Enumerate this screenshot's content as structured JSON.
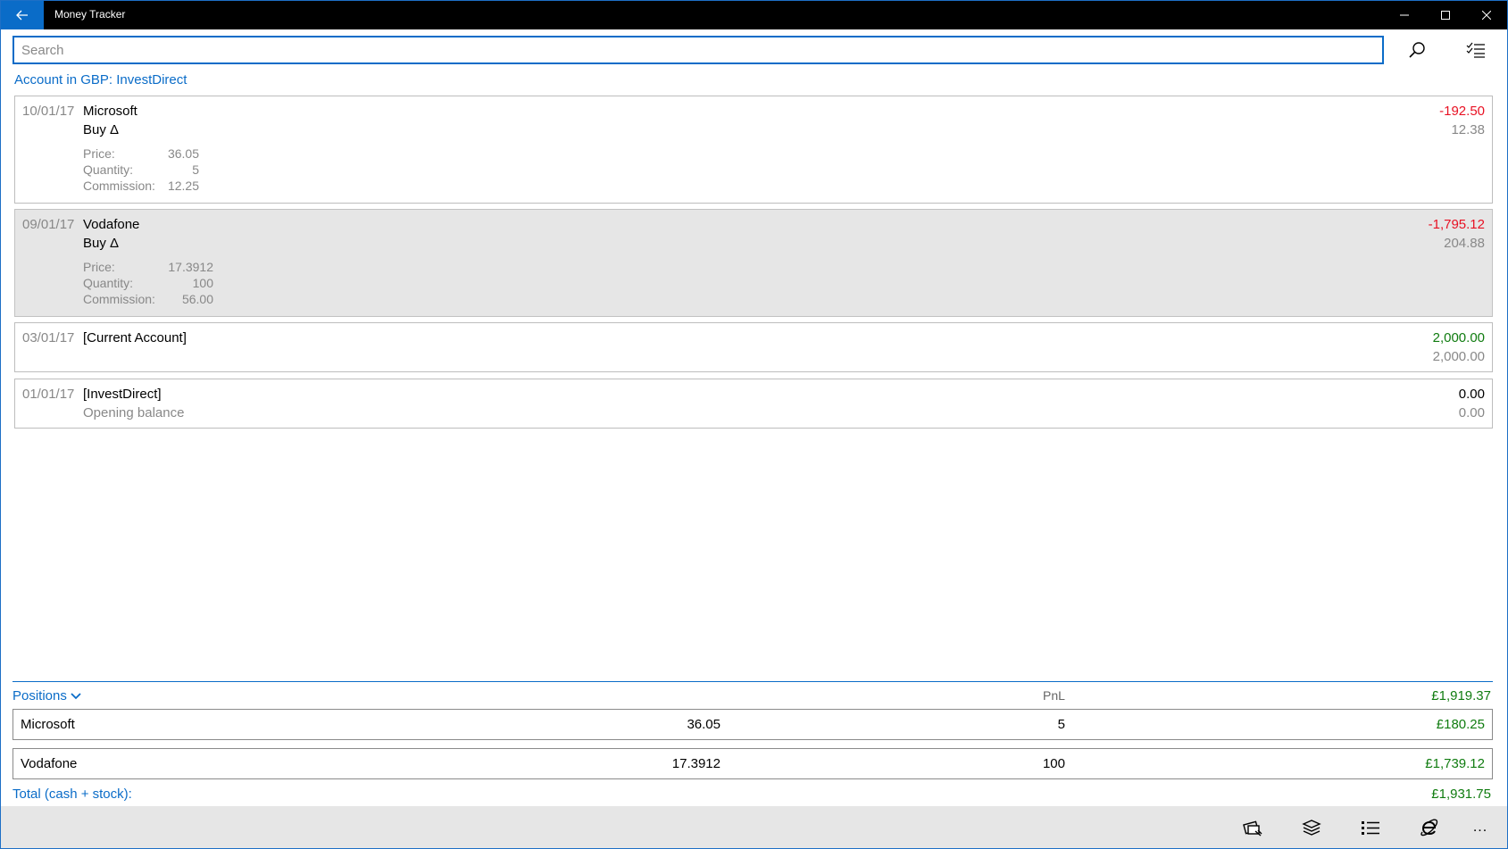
{
  "window": {
    "title": "Money Tracker"
  },
  "search": {
    "placeholder": "Search"
  },
  "account": {
    "title": "Account in GBP: InvestDirect"
  },
  "transactions": [
    {
      "date": "10/01/17",
      "payee": "Microsoft",
      "type": "Buy Δ",
      "amount": "-192.50",
      "balance": "12.38",
      "details": {
        "price_label": "Price:",
        "price": "36.05",
        "quantity_label": "Quantity:",
        "quantity": "5",
        "commission_label": "Commission:",
        "commission": "12.25"
      }
    },
    {
      "date": "09/01/17",
      "payee": "Vodafone",
      "type": "Buy Δ",
      "amount": "-1,795.12",
      "balance": "204.88",
      "details": {
        "price_label": "Price:",
        "price": "17.3912",
        "quantity_label": "Quantity:",
        "quantity": "100",
        "commission_label": "Commission:",
        "commission": "56.00"
      }
    },
    {
      "date": "03/01/17",
      "payee": "[Current Account]",
      "amount": "2,000.00",
      "balance": "2,000.00"
    },
    {
      "date": "01/01/17",
      "payee": "[InvestDirect]",
      "note": "Opening balance",
      "amount": "0.00",
      "balance": "0.00"
    }
  ],
  "positions": {
    "header": "Positions",
    "pnl_label": "PnL",
    "total": "£1,919.37",
    "rows": [
      {
        "name": "Microsoft",
        "price": "36.05",
        "quantity": "5",
        "value": "£180.25"
      },
      {
        "name": "Vodafone",
        "price": "17.3912",
        "quantity": "100",
        "value": "£1,739.12"
      }
    ]
  },
  "grand_total": {
    "label": "Total (cash + stock):",
    "value": "£1,931.75"
  },
  "command_bar": {
    "buttons": [
      "cash-transaction-icon",
      "layers-icon",
      "list-icon",
      "browser-icon"
    ],
    "more": "..."
  },
  "colors": {
    "accent": "#0a6cc8",
    "negative": "#e81123",
    "positive": "#107c10",
    "muted": "#888888",
    "selected_bg": "#e6e6e6"
  }
}
